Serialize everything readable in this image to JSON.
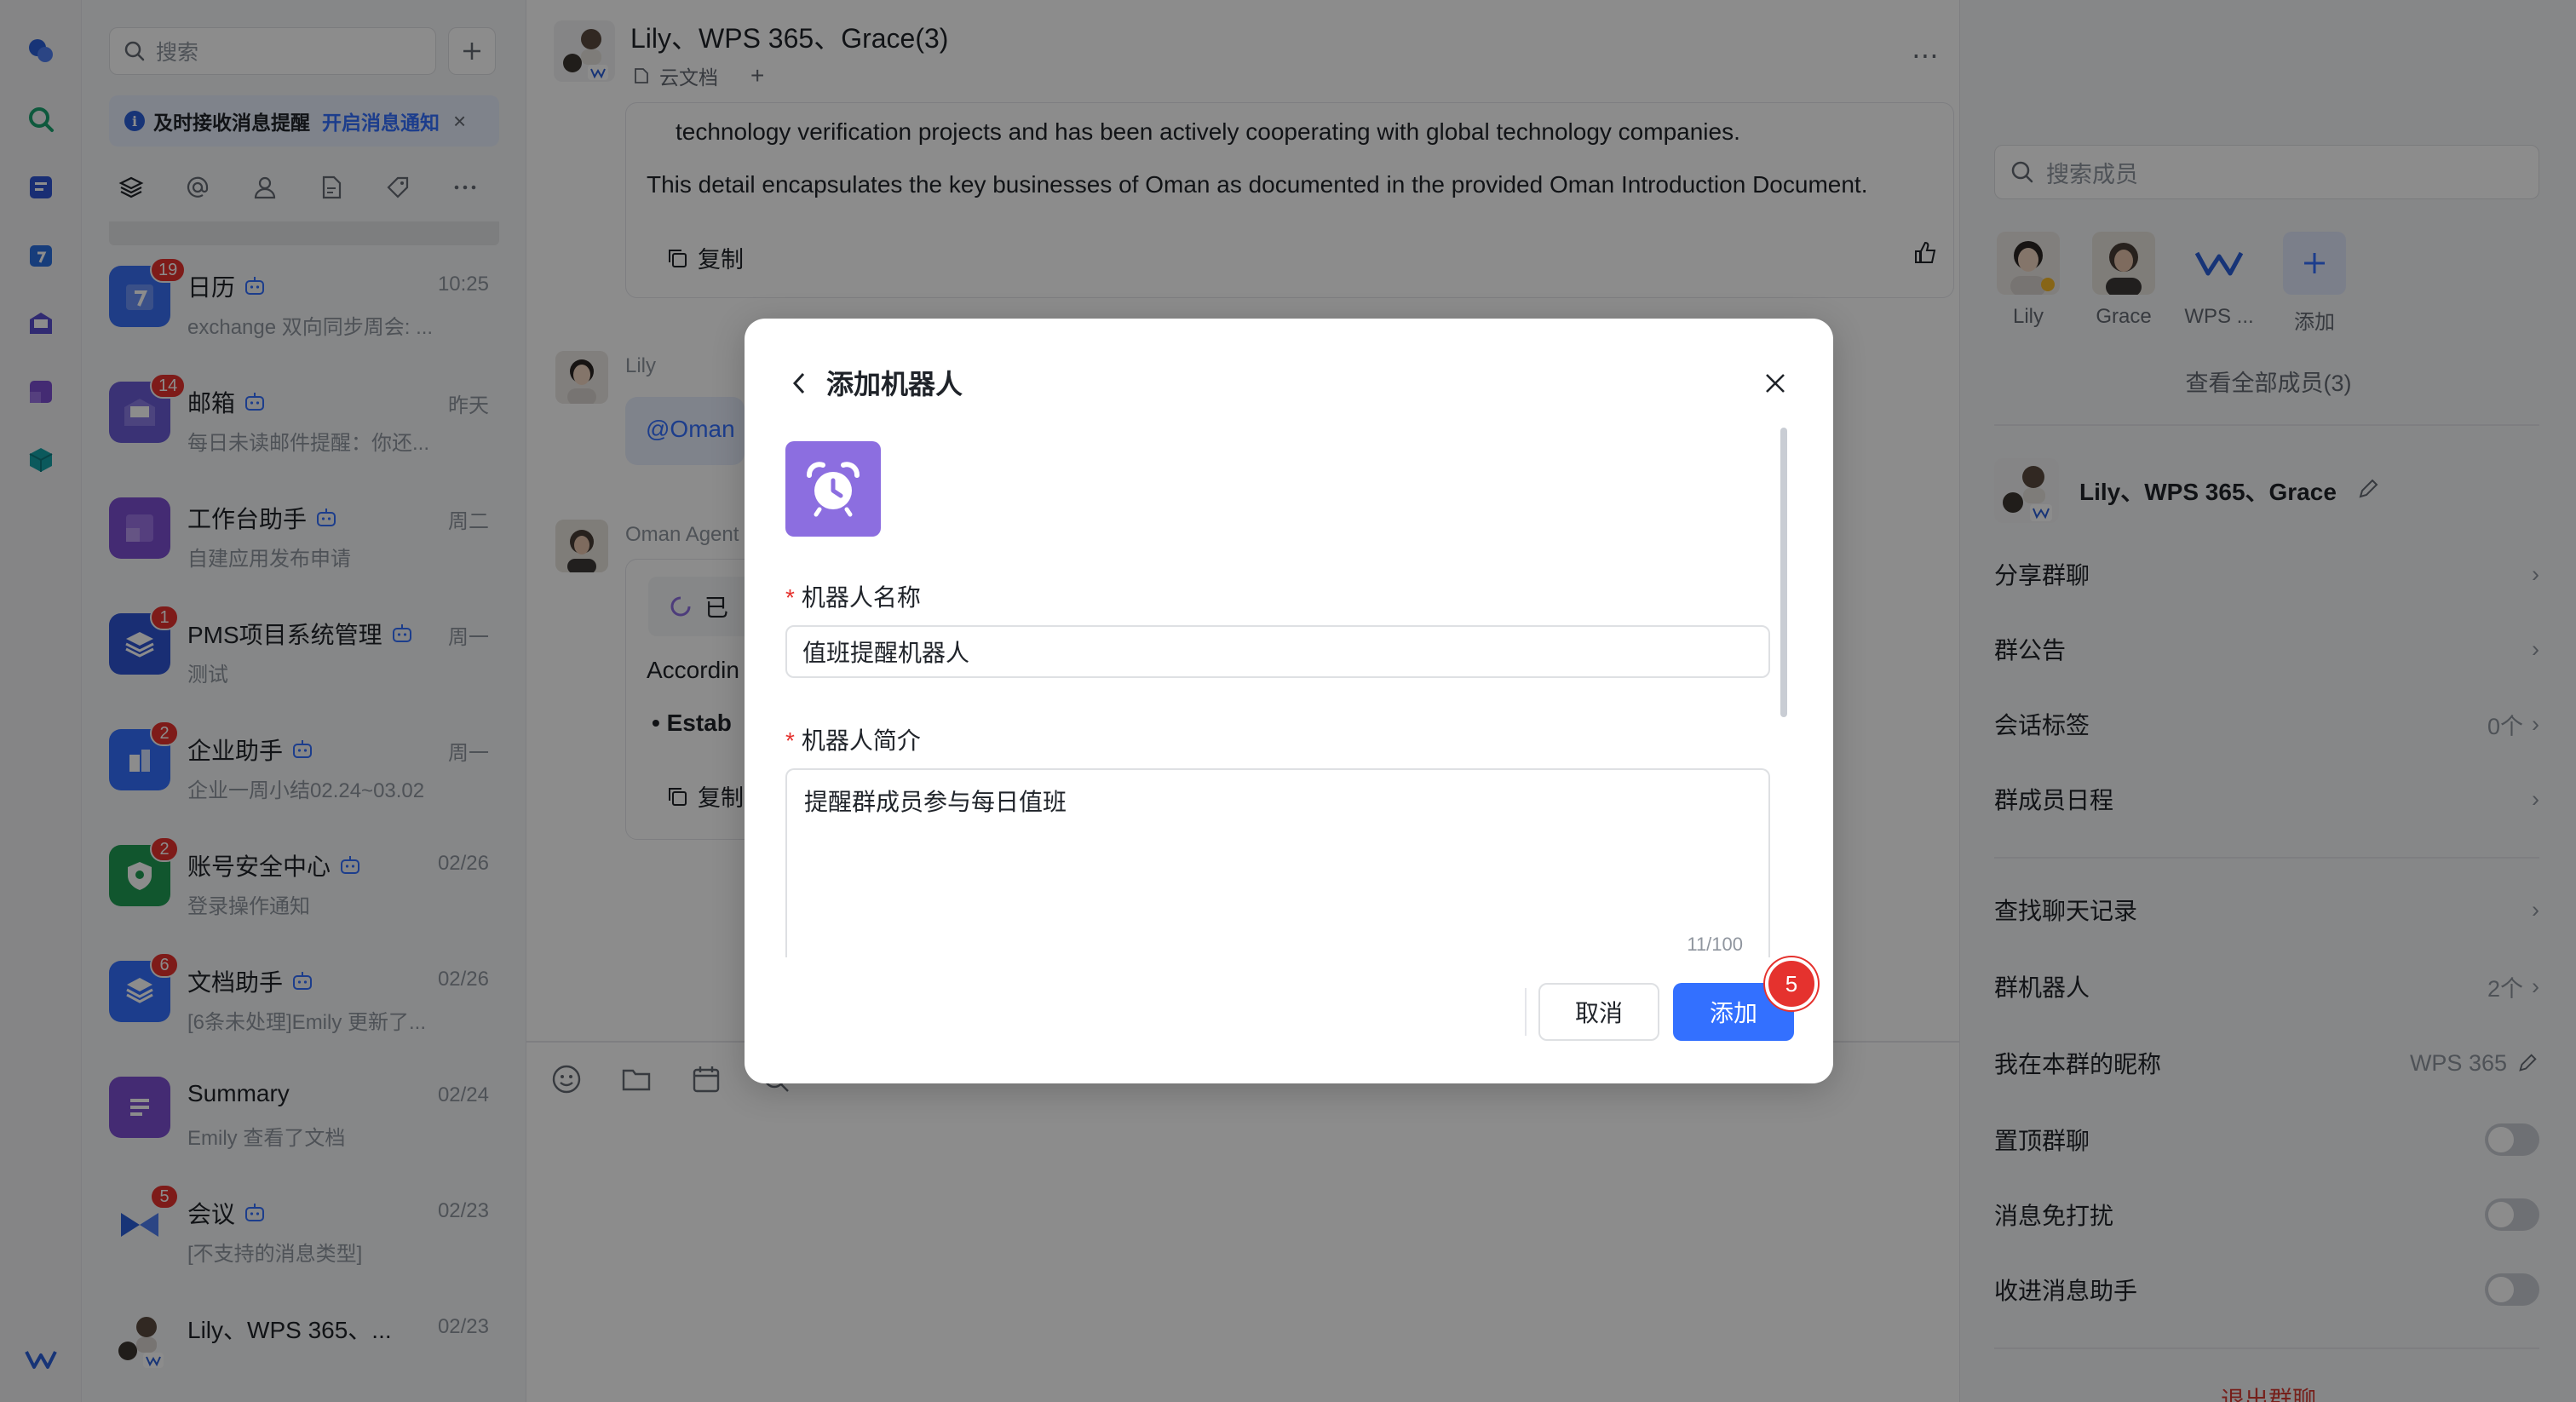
{
  "app_rail": {
    "icons": [
      "chat-icon",
      "search-icon",
      "docs-icon",
      "calendar-icon",
      "mail-icon",
      "workspace-icon",
      "cube-icon",
      "wps-logo-icon"
    ]
  },
  "conv_panel": {
    "search_placeholder": "搜索",
    "notice": {
      "text": "及时接收消息提醒",
      "link": "开启消息通知"
    },
    "conversations": [
      {
        "name": "日历",
        "time": "10:25",
        "preview": "exchange 双向同步周会: ...",
        "badge": "19",
        "color": "#3a6ff5",
        "bot": true
      },
      {
        "name": "邮箱",
        "time": "昨天",
        "preview": "每日未读邮件提醒：你还...",
        "badge": "14",
        "color": "#6a5bd6",
        "bot": true
      },
      {
        "name": "工作台助手",
        "time": "周二",
        "preview": "自建应用发布申请",
        "badge": "",
        "color": "#7d4fd1",
        "bot": true
      },
      {
        "name": "PMS项目系统管理",
        "time": "周一",
        "preview": "测试",
        "badge": "1",
        "color": "#2f55d4",
        "bot": true
      },
      {
        "name": "企业助手",
        "time": "周一",
        "preview": "企业一周小结02.24~03.02",
        "badge": "2",
        "color": "#3370ff",
        "bot": true
      },
      {
        "name": "账号安全中心",
        "time": "02/26",
        "preview": "登录操作通知",
        "badge": "2",
        "color": "#1f9d55",
        "bot": true
      },
      {
        "name": "文档助手",
        "time": "02/26",
        "preview": "[6条未处理]Emily 更新了...",
        "badge": "6",
        "color": "#3370ff",
        "bot": true
      },
      {
        "name": "Summary",
        "time": "02/24",
        "preview": "Emily 查看了文档",
        "badge": "",
        "color": "#7d4fd1",
        "bot": false
      },
      {
        "name": "会议",
        "time": "02/23",
        "preview": "[不支持的消息类型]",
        "badge": "5",
        "color": "#3370ff",
        "bot": true
      },
      {
        "name": "Lily、WPS 365、...",
        "time": "02/23",
        "preview": "",
        "badge": "",
        "color": "#e9e6e1",
        "bot": false
      }
    ]
  },
  "chat": {
    "title": "Lily、WPS 365、Grace(3)",
    "tab": "云文档",
    "msg1_line1": "technology verification projects and has been actively cooperating with global technology companies.",
    "msg1_line2": "This detail encapsulates the key businesses of Oman as documented in the provided Oman Introduction Document.",
    "copy_label": "复制",
    "lily_sender": "Lily",
    "lily_msg": "@Oman",
    "agent_sender": "Oman Agent",
    "agent_status": "已",
    "agent_line": "Accordin",
    "agent_bullet": "Estab",
    "copy_label2": "复制"
  },
  "side": {
    "search_placeholder": "搜索成员",
    "members": [
      {
        "label": "Lily"
      },
      {
        "label": "Grace"
      },
      {
        "label": "WPS ..."
      },
      {
        "label": "添加"
      }
    ],
    "view_all": "查看全部成员(3)",
    "group_name": "Lily、WPS 365、Grace",
    "rows": [
      {
        "label": "分享群聊",
        "value": ""
      },
      {
        "label": "群公告",
        "value": ""
      },
      {
        "label": "会话标签",
        "value": "0个"
      },
      {
        "label": "群成员日程",
        "value": ""
      },
      {
        "label": "查找聊天记录",
        "value": ""
      },
      {
        "label": "群机器人",
        "value": "2个"
      },
      {
        "label": "我在本群的昵称",
        "value": "WPS 365"
      }
    ],
    "toggles": [
      {
        "label": "置顶群聊",
        "on": false
      },
      {
        "label": "消息免打扰",
        "on": false
      },
      {
        "label": "收进消息助手",
        "on": false
      }
    ],
    "exit": "退出群聊"
  },
  "dialog": {
    "title": "添加机器人",
    "name_label": "机器人名称",
    "name_value": "值班提醒机器人",
    "desc_label": "机器人简介",
    "desc_value": "提醒群成员参与每日值班",
    "desc_count": "11/100",
    "cancel": "取消",
    "add": "添加",
    "step_badge": "5"
  },
  "colors": {
    "accent": "#3370ff",
    "danger": "#e5322e",
    "bot_icon_bg": "#8c6ee0"
  }
}
